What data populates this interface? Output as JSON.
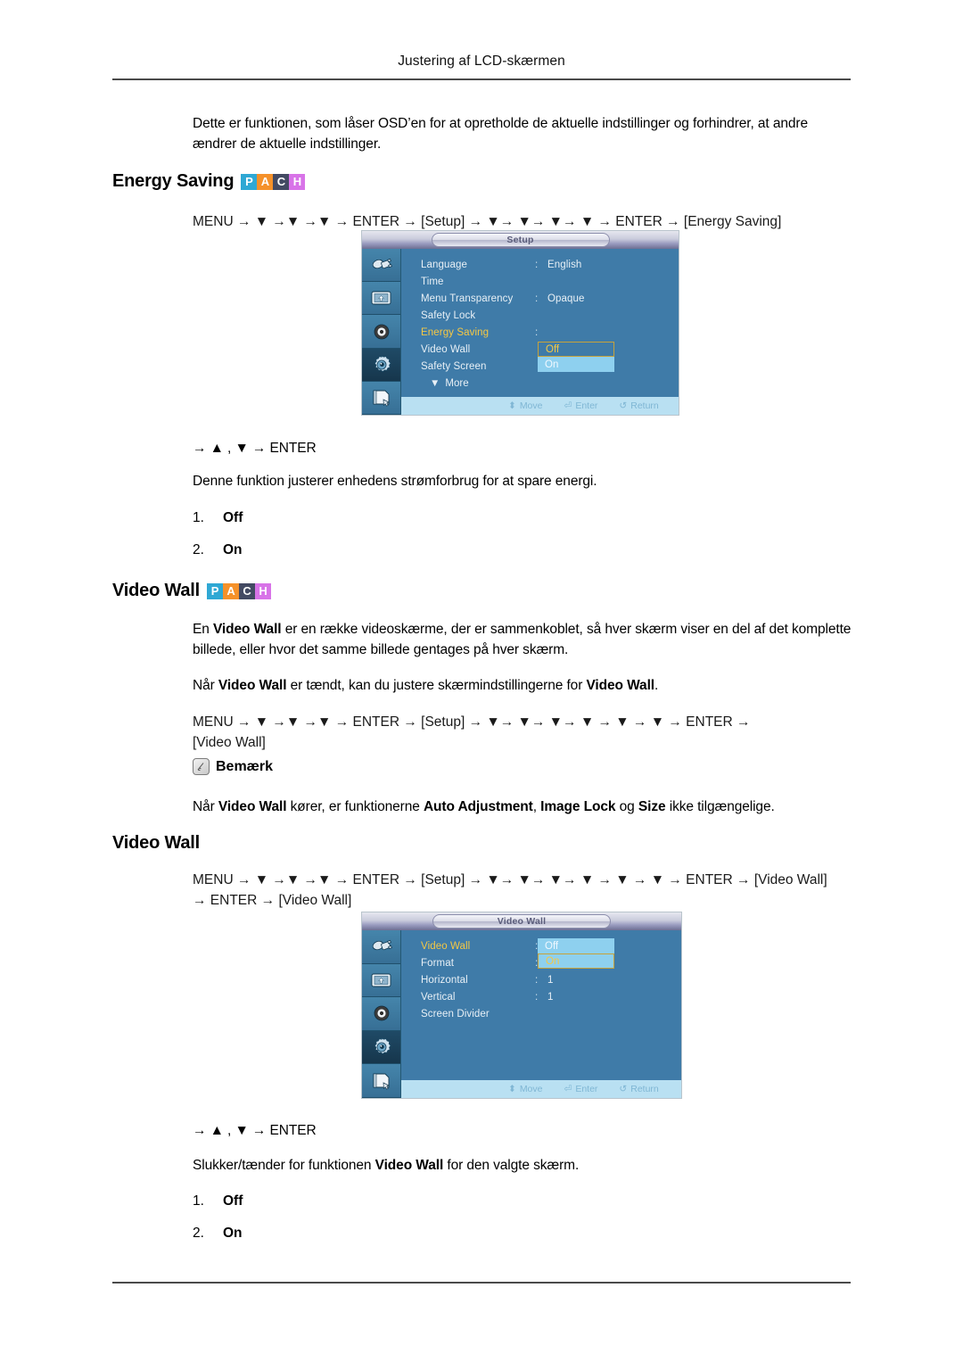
{
  "page": {
    "header_title": "Justering af LCD-skærmen"
  },
  "intro": {
    "text": "Dette er funktionen, som låser OSD’en for at opretholde de aktuelle indstillinger og forhindrer, at andre ændrer de aktuelle indstillinger."
  },
  "badges": {
    "pach": [
      {
        "letter": "P",
        "color": "#2fa8d4"
      },
      {
        "letter": "A",
        "color": "#f5912a"
      },
      {
        "letter": "C",
        "color": "#434a63"
      },
      {
        "letter": "H",
        "color": "#d873e8"
      }
    ]
  },
  "energy_saving": {
    "heading": "Energy Saving",
    "menu_path": "MENU → ▼ →▼ →▼ → ENTER → [Setup] → ▼→ ▼→ ▼→ ▼ → ENTER → [Energy Saving]",
    "menu_tokens": [
      "MENU",
      "→",
      "▼",
      "→",
      "▼",
      "→",
      "▼",
      "→",
      "ENTER",
      "→",
      "[Setup]",
      "→",
      "▼",
      "→",
      "▼",
      "→",
      "▼",
      "→",
      "▼",
      "→",
      "ENTER",
      "→",
      "[Energy Saving]"
    ],
    "key_hint": "→ ▲ , ▼ → ENTER",
    "description": "Denne funktion justerer enhedens strømforbrug for at spare energi.",
    "options": [
      {
        "num": "1.",
        "label": "Off"
      },
      {
        "num": "2.",
        "label": "On"
      }
    ]
  },
  "osd_setup": {
    "title": "Setup",
    "rail_icons": [
      "input-source-icon",
      "picture-display-icon",
      "sound-speaker-icon",
      "setup-gear-icon",
      "multi-control-icon"
    ],
    "active_rail_index": 3,
    "rows": [
      {
        "label": "Language",
        "value": "English",
        "has_colon": true,
        "selected": false
      },
      {
        "label": "Time",
        "value": "",
        "has_colon": false,
        "selected": false
      },
      {
        "label": "Menu Transparency",
        "value": "Opaque",
        "has_colon": true,
        "selected": false
      },
      {
        "label": "Safety Lock",
        "value": "",
        "has_colon": false,
        "selected": false
      },
      {
        "label": "Energy Saving",
        "value": "",
        "has_colon": true,
        "selected": true
      },
      {
        "label": "Video Wall",
        "value": "",
        "has_colon": false,
        "selected": false
      },
      {
        "label": "Safety Screen",
        "value": "",
        "has_colon": false,
        "selected": false
      }
    ],
    "more_label": "More",
    "dropdown": {
      "options": [
        "Off",
        "On"
      ],
      "focused": "Off",
      "highlighted": "On"
    },
    "footer": [
      {
        "icon": "updown-arrow-icon",
        "label": "Move"
      },
      {
        "icon": "enter-key-icon",
        "label": "Enter"
      },
      {
        "icon": "return-arrow-icon",
        "label": "Return"
      }
    ]
  },
  "video_wall_section": {
    "heading": "Video Wall",
    "para1_a": "En ",
    "para1_b": "Video Wall",
    "para1_c": " er en række videoskærme, der er sammenkoblet, så hver skærm viser en del af det komplette billede, eller hvor det samme billede gentages på hver skærm.",
    "para2_a": "Når ",
    "para2_b": "Video Wall",
    "para2_c": " er tændt, kan du justere skærmindstillingerne for ",
    "para2_d": "Video Wall",
    "para2_e": ".",
    "menu_path_line1": "MENU → ▼ →▼ →▼ → ENTER → [Setup] → ▼→ ▼→ ▼→ ▼ → ▼ → ▼ → ENTER →",
    "menu_path_line2": "[Video Wall]",
    "note_label": "Bemærk",
    "note_text_a": "Når ",
    "note_text_b": "Video Wall",
    "note_text_c": " kører, er funktionerne ",
    "note_text_d": "Auto Adjustment",
    "note_text_e": ", ",
    "note_text_f": "Image Lock",
    "note_text_g": " og ",
    "note_text_h": "Size",
    "note_text_i": " ikke tilgængelige."
  },
  "video_wall_sub": {
    "heading": "Video Wall",
    "menu_path_line1": "MENU → ▼ →▼ →▼ → ENTER → [Setup] → ▼→ ▼→ ▼→ ▼ → ▼ → ▼ → ENTER → [Video Wall]",
    "menu_path_line2": "→ ENTER → [Video Wall]",
    "key_hint": "→ ▲ , ▼ → ENTER",
    "description_a": "Slukker/tænder for funktionen ",
    "description_b": "Video Wall",
    "description_c": " for den valgte skærm.",
    "options": [
      {
        "num": "1.",
        "label": "Off"
      },
      {
        "num": "2.",
        "label": "On"
      }
    ]
  },
  "osd_videowall": {
    "title": "Video Wall",
    "rail_icons": [
      "input-source-icon",
      "picture-display-icon",
      "sound-speaker-icon",
      "setup-gear-icon",
      "multi-control-icon"
    ],
    "active_rail_index": 3,
    "rows": [
      {
        "label": "Video Wall",
        "value": "",
        "has_colon": true,
        "selected": true
      },
      {
        "label": "Format",
        "value": "",
        "has_colon": true,
        "selected": false
      },
      {
        "label": "Horizontal",
        "value": "1",
        "has_colon": true,
        "selected": false
      },
      {
        "label": "Vertical",
        "value": "1",
        "has_colon": true,
        "selected": false
      },
      {
        "label": "Screen Divider",
        "value": "",
        "has_colon": false,
        "selected": false
      }
    ],
    "dropdown": {
      "options": [
        "Off",
        "On"
      ],
      "highlighted": "Off",
      "focused": "On"
    },
    "footer": [
      {
        "icon": "updown-arrow-icon",
        "label": "Move"
      },
      {
        "icon": "enter-key-icon",
        "label": "Enter"
      },
      {
        "icon": "return-arrow-icon",
        "label": "Return"
      }
    ]
  }
}
